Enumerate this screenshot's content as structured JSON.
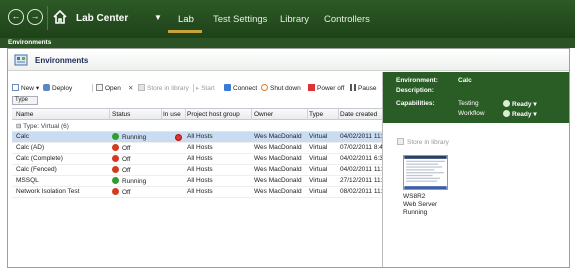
{
  "nav": {
    "back_icon": "back-arrow-icon",
    "forward_icon": "forward-arrow-icon",
    "home_icon": "home-icon",
    "app_title": "Lab Center",
    "dropdown_glyph": "▼",
    "tabs": [
      {
        "label": "Lab",
        "active": true
      },
      {
        "label": "Test Settings",
        "active": false
      },
      {
        "label": "Library",
        "active": false
      },
      {
        "label": "Controllers",
        "active": false
      }
    ],
    "colors": {
      "nav_bg": "#1e4219",
      "active_underline": "#c9a23c"
    }
  },
  "breadcrumb": "Environments",
  "page": {
    "title": "Environments"
  },
  "toolbar": {
    "new": "New",
    "new_arrow": "▾",
    "deploy": "Deploy",
    "open": "Open",
    "delete_glyph": "✕",
    "store": "Store in library",
    "start": "Start",
    "connect": "Connect",
    "shutdown": "Shut down",
    "poweroff": "Power off",
    "pause": "Pause"
  },
  "group_box": "Type",
  "grid": {
    "columns": [
      "Name",
      "Status",
      "In use",
      "Project host group",
      "Owner",
      "Type",
      "Date created"
    ],
    "group": "Type: Virtual (6)",
    "group_glyph": "⊟",
    "rows": [
      {
        "name": "Calc",
        "status": "Running",
        "status_color": "#2e9e2e",
        "in_use": true,
        "host_group": "All Hosts",
        "owner": "Wes MacDonald",
        "type": "Virtual",
        "date": "04/02/2011 11:03",
        "selected": true
      },
      {
        "name": "Calc (AD)",
        "status": "Off",
        "status_color": "#d23b1f",
        "in_use": false,
        "host_group": "All Hosts",
        "owner": "Wes MacDonald",
        "type": "Virtual",
        "date": "07/02/2011 8:45:3",
        "selected": false
      },
      {
        "name": "Calc (Complete)",
        "status": "Off",
        "status_color": "#d23b1f",
        "in_use": false,
        "host_group": "All Hosts",
        "owner": "Wes MacDonald",
        "type": "Virtual",
        "date": "04/02/2011 6:36:5",
        "selected": false
      },
      {
        "name": "Calc (Fenced)",
        "status": "Off",
        "status_color": "#d23b1f",
        "in_use": false,
        "host_group": "All Hosts",
        "owner": "Wes MacDonald",
        "type": "Virtual",
        "date": "04/02/2011 11:09",
        "selected": false
      },
      {
        "name": "MSSQL",
        "status": "Running",
        "status_color": "#2e9e2e",
        "in_use": false,
        "host_group": "All Hosts",
        "owner": "Wes MacDonald",
        "type": "Virtual",
        "date": "27/12/2011 11:16",
        "selected": false
      },
      {
        "name": "Network Isolation Test",
        "status": "Off",
        "status_color": "#d23b1f",
        "in_use": false,
        "host_group": "All Hosts",
        "owner": "Wes MacDonald",
        "type": "Virtual",
        "date": "08/02/2011 11:03",
        "selected": false
      }
    ]
  },
  "detail": {
    "environment_label": "Environment:",
    "environment_value": "Calc",
    "description_label": "Description:",
    "capabilities_label": "Capabilities:",
    "capabilities": [
      {
        "name": "Testing",
        "state": "Ready"
      },
      {
        "name": "Workflow",
        "state": "Ready"
      }
    ],
    "dropdown_glyph": "▾",
    "store_library": "Store in library",
    "vm": {
      "name": "WS8R2",
      "role": "Web Server",
      "status": "Running"
    }
  }
}
